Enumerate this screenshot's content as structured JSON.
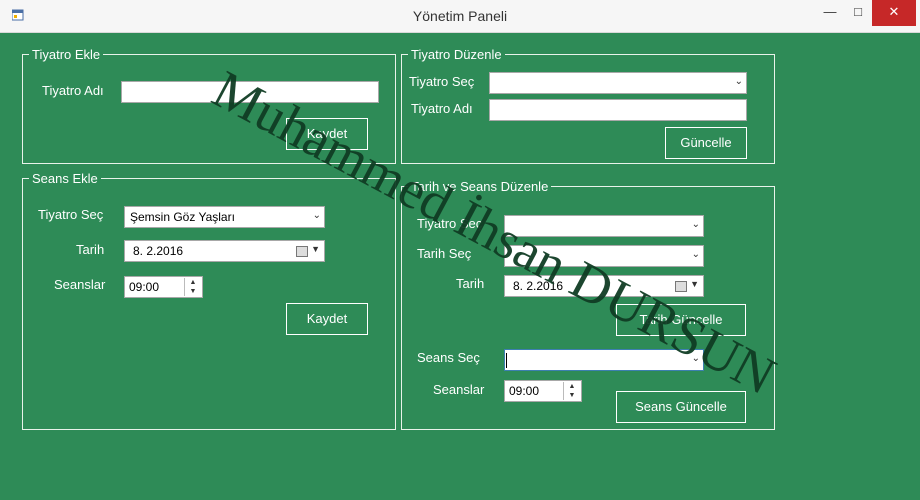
{
  "window": {
    "title": "Yönetim Paneli"
  },
  "groups": {
    "tiyatro_ekle": {
      "legend": "Tiyatro Ekle",
      "name_label": "Tiyatro Adı",
      "name_value": "",
      "save_label": "Kaydet"
    },
    "tiyatro_duzenle": {
      "legend": "Tiyatro Düzenle",
      "select_label": "Tiyatro Seç",
      "selected_value": "",
      "name_label": "Tiyatro Adı",
      "name_value": "",
      "update_label": "Güncelle"
    },
    "seans_ekle": {
      "legend": "Seans Ekle",
      "tiyatro_label": "Tiyatro Seç",
      "tiyatro_value": "Şemsin Göz Yaşları",
      "tarih_label": "Tarih",
      "tarih_value": "8.  2.2016",
      "seans_label": "Seanslar",
      "seans_value": "09:00",
      "save_label": "Kaydet"
    },
    "tarih_seans_duzenle": {
      "legend": "Tarih ve Seans Düzenle",
      "tiyatro_label": "Tiyatro Seç",
      "tiyatro_value": "",
      "tarih_select_label": "Tarih Seç",
      "tarih_select_value": "",
      "tarih_label": "Tarih",
      "tarih_value": "8.  2.2016",
      "tarih_update_label": "Tarih Güncelle",
      "seans_select_label": "Seans Seç",
      "seans_select_value": "",
      "seans_label": "Seanslar",
      "seans_value": "09:00",
      "seans_update_label": "Seans Güncelle"
    }
  },
  "watermark": "Muhammed İhsan DURSUN",
  "icons": {
    "app": "form-icon",
    "minimize": "minimize-icon",
    "maximize": "maximize-icon",
    "close": "close-icon"
  }
}
